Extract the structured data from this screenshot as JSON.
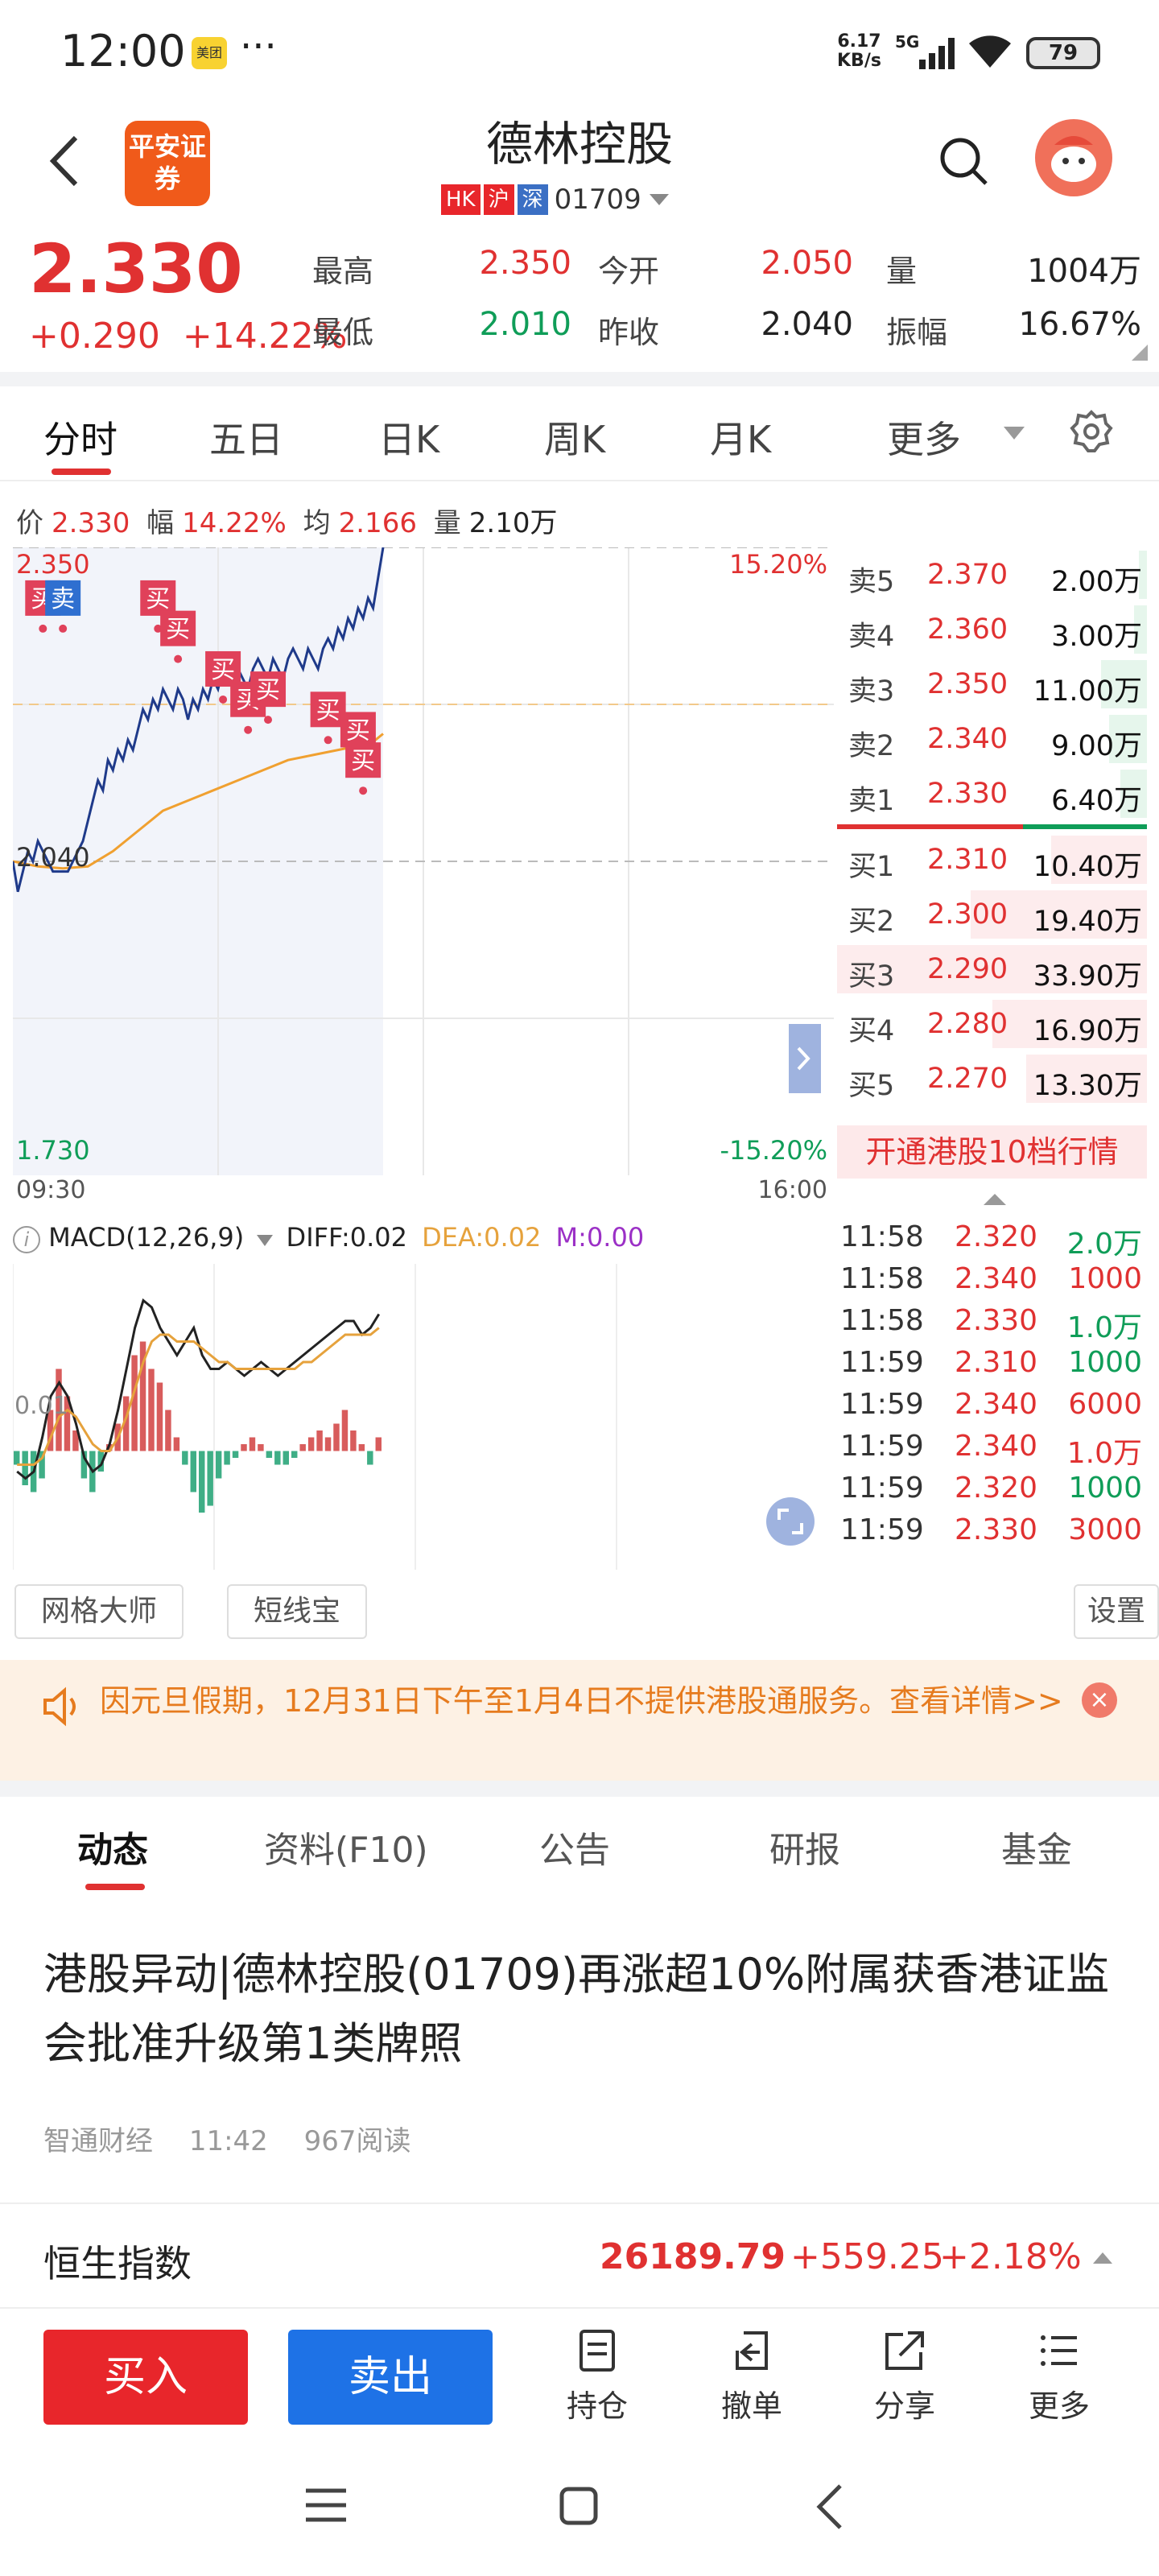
{
  "status_bar": {
    "time": "12:00",
    "app_icon_label": "美团",
    "more": "···",
    "speed_value": "6.17",
    "speed_unit": "KB/s",
    "network": "5G",
    "battery": "79"
  },
  "header": {
    "broker_logo": "平安证券",
    "stock_name": "德林控股",
    "badges": [
      {
        "label": "HK",
        "color": "#e8262b"
      },
      {
        "label": "沪",
        "color": "#e8262b"
      },
      {
        "label": "深",
        "color": "#3b6fc4"
      }
    ],
    "stock_code": "01709",
    "icons": {
      "back": "back-icon",
      "search": "search-icon",
      "avatar": "avatar"
    }
  },
  "quote": {
    "price": "2.330",
    "change": "+0.290",
    "change_pct": "+14.22%",
    "fields": [
      {
        "label": "最高",
        "value": "2.350",
        "tone": "red"
      },
      {
        "label": "今开",
        "value": "2.050",
        "tone": "red"
      },
      {
        "label": "量",
        "value": "1004万",
        "tone": "black"
      },
      {
        "label": "最低",
        "value": "2.010",
        "tone": "green"
      },
      {
        "label": "昨收",
        "value": "2.040",
        "tone": "black"
      },
      {
        "label": "振幅",
        "value": "16.67%",
        "tone": "black"
      }
    ]
  },
  "period_tabs": {
    "items": [
      "分时",
      "五日",
      "日K",
      "周K",
      "月K",
      "更多"
    ],
    "active_index": 0
  },
  "chart_info": {
    "price_label": "价",
    "price": "2.330",
    "range_label": "幅",
    "range": "14.22%",
    "avg_label": "均",
    "avg": "2.166",
    "vol_label": "量",
    "vol": "2.10万"
  },
  "chart_data": [
    {
      "type": "line",
      "title": "",
      "x_axis_labels": [
        "09:30",
        "16:00"
      ],
      "y_axis_left_labels": [
        "2.350",
        "2.040",
        "1.730"
      ],
      "y_axis_right_labels": [
        "15.20%",
        "-15.20%"
      ],
      "ylim": [
        1.73,
        2.35
      ],
      "reference_line": 2.04,
      "series": [
        {
          "x": [
            0,
            2,
            4,
            6,
            8,
            10,
            12,
            14,
            16,
            18,
            20,
            22,
            24,
            26,
            28,
            30,
            32,
            34,
            36,
            38,
            40,
            42,
            44,
            46,
            48,
            50,
            52,
            54,
            56,
            58,
            60,
            62,
            64,
            66,
            68,
            70,
            72,
            74,
            76,
            78,
            80,
            82,
            84,
            86,
            88,
            90,
            92,
            94,
            96,
            98,
            100,
            102,
            104,
            106,
            108,
            110,
            112,
            114,
            116,
            118,
            120,
            122,
            124,
            126,
            128,
            130,
            132,
            134,
            136,
            138,
            140,
            142,
            144,
            146,
            148
          ],
          "y": [
            2.04,
            2.01,
            2.03,
            2.05,
            2.04,
            2.06,
            2.05,
            2.04,
            2.03,
            2.03,
            2.03,
            2.03,
            2.04,
            2.05,
            2.06,
            2.08,
            2.1,
            2.12,
            2.11,
            2.14,
            2.13,
            2.15,
            2.14,
            2.16,
            2.15,
            2.17,
            2.19,
            2.18,
            2.2,
            2.19,
            2.21,
            2.2,
            2.19,
            2.21,
            2.2,
            2.18,
            2.2,
            2.19,
            2.21,
            2.2,
            2.22,
            2.21,
            2.23,
            2.22,
            2.21,
            2.23,
            2.22,
            2.21,
            2.23,
            2.24,
            2.23,
            2.22,
            2.24,
            2.23,
            2.22,
            2.24,
            2.25,
            2.24,
            2.23,
            2.25,
            2.24,
            2.23,
            2.25,
            2.26,
            2.25,
            2.27,
            2.26,
            2.28,
            2.27,
            2.29,
            2.28,
            2.3,
            2.29,
            2.32,
            2.35
          ]
        },
        {
          "x": [
            0,
            10,
            20,
            30,
            40,
            50,
            60,
            70,
            80,
            90,
            100,
            110,
            120,
            130,
            140,
            145,
            148
          ],
          "y": [
            2.04,
            2.035,
            2.033,
            2.035,
            2.05,
            2.07,
            2.09,
            2.1,
            2.11,
            2.12,
            2.13,
            2.14,
            2.145,
            2.15,
            2.155,
            2.16,
            2.166
          ]
        }
      ],
      "trade_markers": [
        {
          "label": "买",
          "x": 12,
          "y": 2.3
        },
        {
          "label": "卖",
          "x": 20,
          "y": 2.3
        },
        {
          "label": "买",
          "x": 58,
          "y": 2.3
        },
        {
          "label": "买",
          "x": 66,
          "y": 2.27
        },
        {
          "label": "买",
          "x": 84,
          "y": 2.23
        },
        {
          "label": "买",
          "x": 94,
          "y": 2.2
        },
        {
          "label": "买",
          "x": 102,
          "y": 2.21
        },
        {
          "label": "买",
          "x": 126,
          "y": 2.19
        },
        {
          "label": "买",
          "x": 138,
          "y": 2.17
        },
        {
          "label": "买",
          "x": 140,
          "y": 2.14
        }
      ]
    },
    {
      "type": "bar",
      "title": "MACD(12,26,9)",
      "indicators": [
        {
          "name": "DIFF",
          "value": "0.02",
          "color": "#222222"
        },
        {
          "name": "DEA",
          "value": "0.02",
          "color": "#e6a23c"
        },
        {
          "name": "M",
          "value": "0.00",
          "color": "#9b30c6"
        }
      ],
      "y_axis_label": "0.01",
      "ylim": [
        -0.015,
        0.025
      ],
      "bars": [
        -0.002,
        -0.005,
        -0.006,
        -0.004,
        0.006,
        0.012,
        0.008,
        0.003,
        -0.004,
        -0.006,
        -0.003,
        0.001,
        0.004,
        0.008,
        0.014,
        0.016,
        0.012,
        0.01,
        0.006,
        0.002,
        -0.002,
        -0.006,
        -0.009,
        -0.008,
        -0.004,
        -0.002,
        -0.001,
        0.001,
        0.002,
        0.001,
        -0.001,
        -0.002,
        -0.002,
        -0.001,
        0.001,
        0.002,
        0.003,
        0.002,
        0.004,
        0.006,
        0.003,
        0.001,
        -0.002,
        0.002
      ],
      "diff_line": [
        -0.003,
        -0.004,
        -0.003,
        0.002,
        0.008,
        0.01,
        0.008,
        0.004,
        -0.001,
        -0.003,
        -0.002,
        0.001,
        0.006,
        0.012,
        0.018,
        0.022,
        0.021,
        0.018,
        0.016,
        0.014,
        0.016,
        0.018,
        0.014,
        0.012,
        0.012,
        0.013,
        0.012,
        0.011,
        0.012,
        0.013,
        0.012,
        0.011,
        0.012,
        0.013,
        0.014,
        0.015,
        0.016,
        0.017,
        0.018,
        0.019,
        0.019,
        0.017,
        0.018,
        0.02
      ],
      "dea_line": [
        -0.002,
        -0.002,
        -0.002,
        -0.001,
        0.002,
        0.005,
        0.006,
        0.005,
        0.003,
        0.001,
        0.0,
        0.0,
        0.002,
        0.005,
        0.009,
        0.013,
        0.016,
        0.017,
        0.017,
        0.016,
        0.016,
        0.016,
        0.015,
        0.014,
        0.013,
        0.013,
        0.012,
        0.012,
        0.012,
        0.012,
        0.012,
        0.012,
        0.012,
        0.012,
        0.013,
        0.013,
        0.014,
        0.015,
        0.016,
        0.017,
        0.017,
        0.017,
        0.017,
        0.018
      ]
    }
  ],
  "order_book": {
    "asks": [
      {
        "label": "卖5",
        "price": "2.370",
        "volume": "2.00万",
        "depth": 0.06
      },
      {
        "label": "卖4",
        "price": "2.360",
        "volume": "3.00万",
        "depth": 0.09
      },
      {
        "label": "卖3",
        "price": "2.350",
        "volume": "11.00万",
        "depth": 0.33
      },
      {
        "label": "卖2",
        "price": "2.340",
        "volume": "9.00万",
        "depth": 0.27
      },
      {
        "label": "卖1",
        "price": "2.330",
        "volume": "6.40万",
        "depth": 0.19
      }
    ],
    "bids": [
      {
        "label": "买1",
        "price": "2.310",
        "volume": "10.40万",
        "depth": 0.31
      },
      {
        "label": "买2",
        "price": "2.300",
        "volume": "19.40万",
        "depth": 0.57
      },
      {
        "label": "买3",
        "price": "2.290",
        "volume": "33.90万",
        "depth": 1.0
      },
      {
        "label": "买4",
        "price": "2.280",
        "volume": "16.90万",
        "depth": 0.5
      },
      {
        "label": "买5",
        "price": "2.270",
        "volume": "13.30万",
        "depth": 0.39
      }
    ],
    "subscribe_label": "开通港股10档行情"
  },
  "ticks": [
    {
      "time": "11:58",
      "price": "2.320",
      "volume": "2.0万",
      "tone": "green"
    },
    {
      "time": "11:58",
      "price": "2.340",
      "volume": "1000",
      "tone": "red"
    },
    {
      "time": "11:58",
      "price": "2.330",
      "volume": "1.0万",
      "tone": "green"
    },
    {
      "time": "11:59",
      "price": "2.310",
      "volume": "1000",
      "tone": "green"
    },
    {
      "time": "11:59",
      "price": "2.340",
      "volume": "6000",
      "tone": "red"
    },
    {
      "time": "11:59",
      "price": "2.340",
      "volume": "1.0万",
      "tone": "red"
    },
    {
      "time": "11:59",
      "price": "2.320",
      "volume": "1000",
      "tone": "green"
    },
    {
      "time": "11:59",
      "price": "2.330",
      "volume": "3000",
      "tone": "red"
    }
  ],
  "tools": {
    "grid_master": "网格大师",
    "short_line": "短线宝",
    "settings": "设置"
  },
  "notice": {
    "text": "因元旦假期，12月31日下午至1月4日不提供港股通服务。查看详情>>",
    "close": "×"
  },
  "content_tabs": {
    "items": [
      "动态",
      "资料(F10)",
      "公告",
      "研报",
      "基金"
    ],
    "active_index": 0
  },
  "news": {
    "title": "港股异动|德林控股(01709)再涨超10%附属获香港证监会批准升级第1类牌照",
    "source": "智通财经",
    "time": "11:42",
    "reads": "967阅读"
  },
  "index": {
    "name": "恒生指数",
    "value": "26189.79",
    "change": "+559.25",
    "pct": "+2.18%"
  },
  "actions": {
    "buy": "买入",
    "sell": "卖出",
    "items": [
      {
        "label": "持仓",
        "icon": "holdings-icon"
      },
      {
        "label": "撤单",
        "icon": "cancel-order-icon"
      },
      {
        "label": "分享",
        "icon": "share-icon"
      },
      {
        "label": "更多",
        "icon": "more-menu-icon"
      }
    ]
  },
  "colors": {
    "up": "#e03131",
    "down": "#0f9d58",
    "price_line": "#1f3a8a",
    "avg_line": "#f0a030",
    "brand_orange": "#f05a1a"
  }
}
